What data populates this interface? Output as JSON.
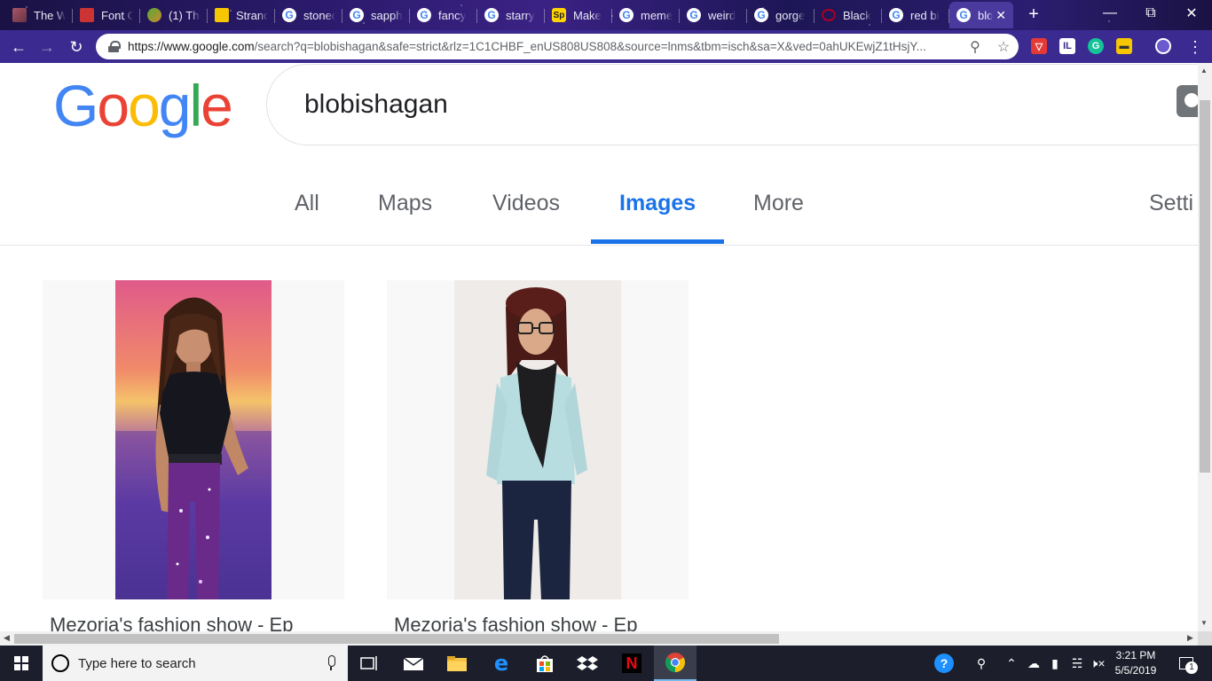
{
  "browser": {
    "tabs": [
      {
        "label": "The W",
        "icon": "photo-favicon"
      },
      {
        "label": "Font C",
        "icon": "red-favicon"
      },
      {
        "label": "(1) The",
        "icon": "leaf-favicon"
      },
      {
        "label": "Strand",
        "icon": "yellow-doc-favicon"
      },
      {
        "label": "stoned",
        "icon": "google-favicon"
      },
      {
        "label": "sapphi",
        "icon": "google-favicon"
      },
      {
        "label": "fancy",
        "icon": "google-favicon"
      },
      {
        "label": "starry",
        "icon": "google-favicon"
      },
      {
        "label": "Make",
        "icon": "sp-favicon"
      },
      {
        "label": "meme",
        "icon": "google-favicon"
      },
      {
        "label": "weird",
        "icon": "google-favicon"
      },
      {
        "label": "gorge",
        "icon": "google-favicon"
      },
      {
        "label": "Black",
        "icon": "dark-favicon"
      },
      {
        "label": "red bi",
        "icon": "google-favicon"
      },
      {
        "label": "blo",
        "icon": "google-favicon",
        "active": true
      }
    ],
    "address": {
      "host": "https://www.google.com",
      "path": "/search?q=blobishagan&safe=strict&rlz=1C1CHBF_enUS808US808&source=lnms&tbm=isch&sa=X&ved=0ahUKEwjZ1tHsjY..."
    }
  },
  "google": {
    "logo_letters": [
      {
        "ch": "G",
        "color": "#4285F4"
      },
      {
        "ch": "o",
        "color": "#EA4335"
      },
      {
        "ch": "o",
        "color": "#FBBC05"
      },
      {
        "ch": "g",
        "color": "#4285F4"
      },
      {
        "ch": "l",
        "color": "#34A853"
      },
      {
        "ch": "e",
        "color": "#EA4335"
      }
    ],
    "query": "blobishagan",
    "nav": {
      "all": "All",
      "maps": "Maps",
      "videos": "Videos",
      "images": "Images",
      "more": "More",
      "settings": "Setti"
    },
    "results": [
      {
        "caption": "Mezoria's fashion show - Ep"
      },
      {
        "caption": "Mezoria's fashion show - Ep"
      }
    ]
  },
  "taskbar": {
    "search_placeholder": "Type here to search",
    "time": "3:21 PM",
    "date": "5/5/2019",
    "notifications": "1"
  },
  "colors": {
    "accent_blue": "#1a73e8",
    "chrome_frame": "#3b2a8f"
  }
}
